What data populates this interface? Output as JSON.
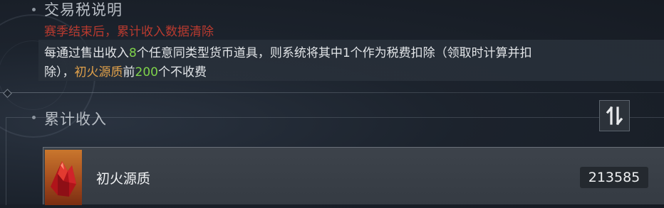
{
  "tax_section": {
    "title": "交易税说明",
    "warning": "赛季结束后，累计收入数据清除",
    "desc_line1": {
      "prefix": "每通过售出收入",
      "count": "8",
      "suffix": "个任意同类型货币道具，则系统将其中1个作为税费扣除（领取时计算并扣"
    },
    "desc_line2": {
      "prefix": "除），",
      "currency": "初火源质",
      "mid": "前",
      "limit": "200",
      "suffix": "个不收费"
    }
  },
  "income_section": {
    "title": "累计收入",
    "sort_icon": "sort-toggle-icon",
    "items": [
      {
        "name": "初火源质",
        "amount": "213585",
        "icon": "red-crystal-icon"
      }
    ]
  },
  "colors": {
    "warning": "#b93a2f",
    "green_highlight": "#7fd34a",
    "orange_highlight": "#e0a14b"
  }
}
